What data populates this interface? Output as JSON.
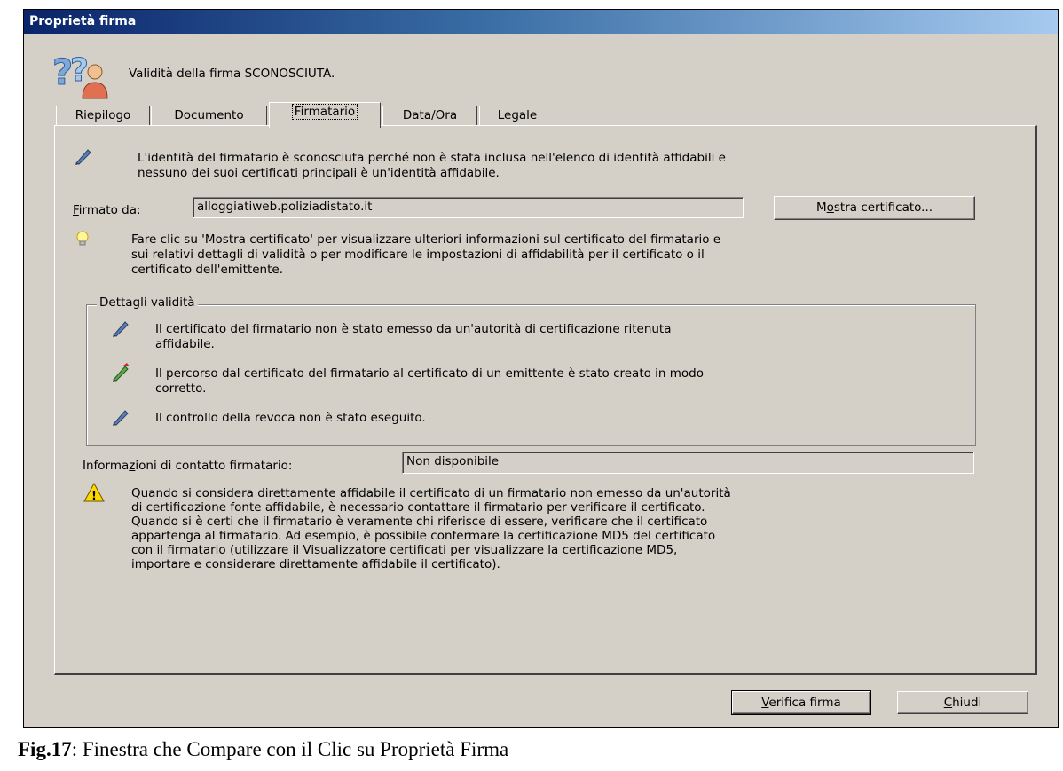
{
  "window": {
    "title": "Proprietà firma"
  },
  "header": {
    "status_text": "Validità della firma SCONOSCIUTA."
  },
  "tabs": [
    {
      "label": "Riepilogo"
    },
    {
      "label": "Documento"
    },
    {
      "label": "Firmatario"
    },
    {
      "label": "Data/Ora"
    },
    {
      "label": "Legale"
    }
  ],
  "signer": {
    "identity_line1": "L'identità del firmatario è sconosciuta perché non è stata inclusa nell'elenco di identità affidabili e",
    "identity_line2": "nessuno dei suoi certificati principali è un'identità affidabile.",
    "signed_by_label_key": "F",
    "signed_by_label_rest": "irmato da:",
    "signed_by_value": "alloggiatiweb.poliziadistato.it",
    "show_cert_pre": "M",
    "show_cert_key": "o",
    "show_cert_post": "stra certificato...",
    "tip_line1": "Fare clic su 'Mostra certificato' per visualizzare ulteriori informazioni sul certificato del firmatario e",
    "tip_line2": "sui relativi dettagli di validità o per modificare le impostazioni di affidabilità per il certificato o il",
    "tip_line3": "certificato dell'emittente."
  },
  "validity": {
    "legend": "Dettagli validità",
    "item1_line1": "Il certificato del firmatario non è stato emesso da un'autorità di certificazione ritenuta",
    "item1_line2": "affidabile.",
    "item2_line1": "Il percorso dal certificato del firmatario al certificato di un emittente è stato creato in modo",
    "item2_line2": "corretto.",
    "item3": "Il controllo della revoca non è stato eseguito."
  },
  "contact": {
    "label_pre": "Informa",
    "label_key": "z",
    "label_post": "ioni di contatto firmatario:",
    "value": "Non disponibile"
  },
  "warning": {
    "lines": [
      "Quando si considera direttamente affidabile il certificato di un firmatario non emesso da un'autorità",
      "di certificazione fonte affidabile, è necessario contattare il firmatario per verificare il certificato.",
      "Quando si è certi che il firmatario è veramente chi riferisce di essere, verificare che il certificato",
      "appartenga al firmatario. Ad esempio, è possibile confermare la certificazione MD5 del certificato",
      "con il firmatario (utilizzare il Visualizzatore certificati per visualizzare la certificazione MD5,",
      "importare e considerare direttamente affidabile il certificato)."
    ]
  },
  "buttons": {
    "verify_key": "V",
    "verify_rest": "erifica firma",
    "close_key": "C",
    "close_rest": "hiudi"
  },
  "caption": {
    "bold": "Fig.17",
    "rest": ": Finestra che Compare con il Clic su Proprietà Firma"
  },
  "icons": {
    "header": "question-user-icon",
    "pen": "pen-question-icon",
    "pen_ok": "pen-check-icon",
    "tip": "lightbulb-icon",
    "warning": "warning-icon"
  }
}
